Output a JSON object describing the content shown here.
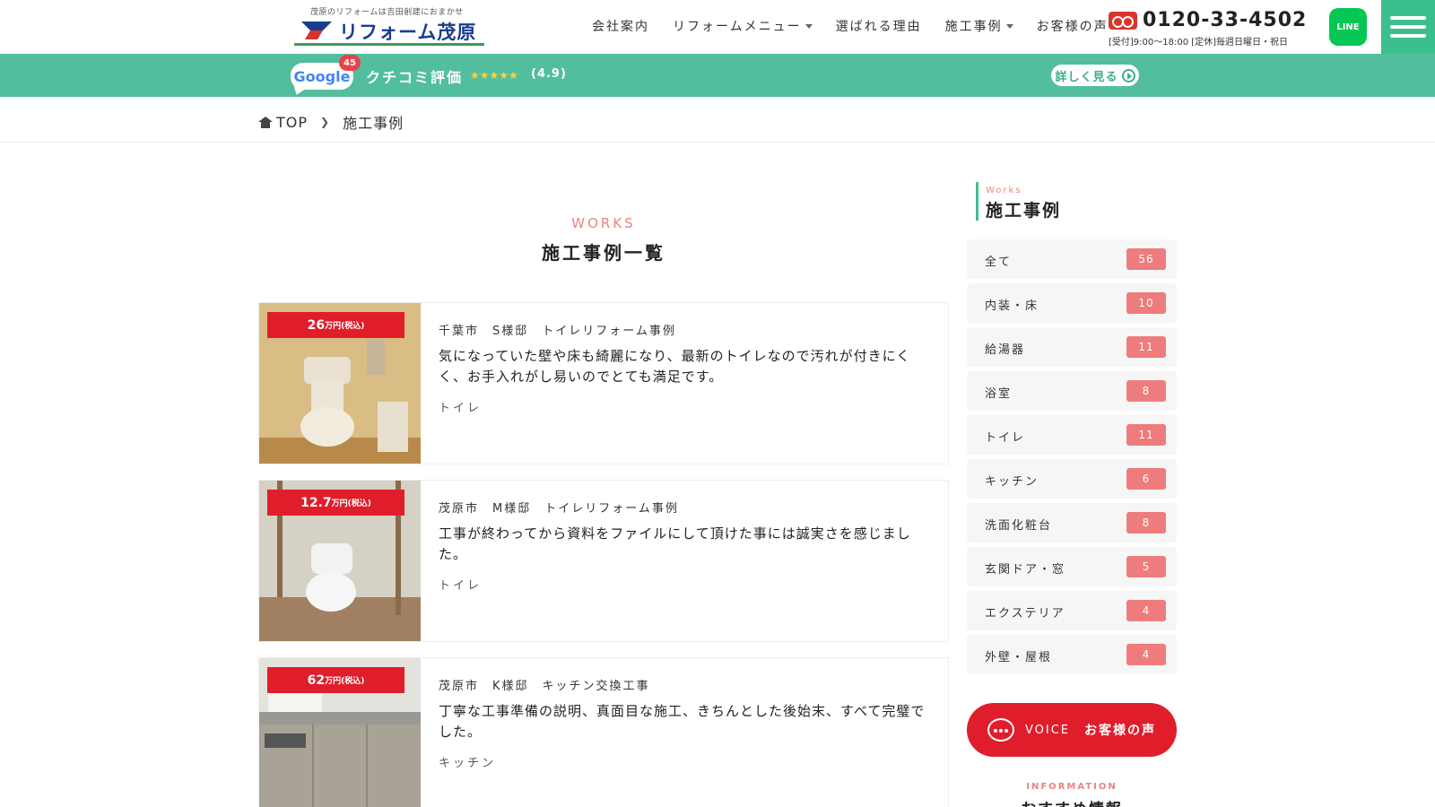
{
  "header": {
    "logo_tagline": "茂原のリフォームは吉田創建におまかせ",
    "logo_name": "リフォーム茂原",
    "nav": [
      {
        "label": "会社案内",
        "dropdown": false
      },
      {
        "label": "リフォームメニュー",
        "dropdown": true
      },
      {
        "label": "選ばれる理由",
        "dropdown": false
      },
      {
        "label": "施工事例",
        "dropdown": true
      },
      {
        "label": "お客様の声",
        "dropdown": false
      }
    ],
    "tel_number": "0120-33-4502",
    "tel_hours": "[受付]9:00〜18:00 [定休]毎週日曜日・祝日",
    "line_label": "LINE"
  },
  "review": {
    "google_label": "Google",
    "google_count": "45",
    "label": "クチコミ評価",
    "stars": "★★★★★",
    "score": "(4.9)",
    "detail_label": "詳しく見る"
  },
  "breadcrumb": {
    "home": "TOP",
    "current": "施工事例"
  },
  "main": {
    "heading_en": "WORKS",
    "heading_ja": "施工事例一覧",
    "cards": [
      {
        "price": "26",
        "unit": "万円(税込)",
        "title": "千葉市　S様邸　トイレリフォーム事例",
        "body": "気になっていた壁や床も綺麗になり、最新のトイレなので汚れが付きにくく、お手入れがし易いのでとても満足です。",
        "category": "トイレ"
      },
      {
        "price": "12.7",
        "unit": "万円(税込)",
        "title": "茂原市　M様邸　トイレリフォーム事例",
        "body": "工事が終わってから資料をファイルにして頂けた事には誠実さを感じました。",
        "category": "トイレ"
      },
      {
        "price": "62",
        "unit": "万円(税込)",
        "title": "茂原市　K様邸　キッチン交換工事",
        "body": "丁寧な工事準備の説明、真面目な施工、きちんとした後始末、すべて完璧でした。",
        "category": "キッチン"
      }
    ]
  },
  "sidebar": {
    "heading_en": "Works",
    "heading_ja": "施工事例",
    "categories": [
      {
        "label": "全て",
        "count": "56"
      },
      {
        "label": "内装・床",
        "count": "10"
      },
      {
        "label": "給湯器",
        "count": "11"
      },
      {
        "label": "浴室",
        "count": "8"
      },
      {
        "label": "トイレ",
        "count": "11"
      },
      {
        "label": "キッチン",
        "count": "6"
      },
      {
        "label": "洗面化粧台",
        "count": "8"
      },
      {
        "label": "玄関ドア・窓",
        "count": "5"
      },
      {
        "label": "エクステリア",
        "count": "4"
      },
      {
        "label": "外壁・屋根",
        "count": "4"
      }
    ],
    "voice_en": "VOICE",
    "voice_ja": "お客様の声",
    "info_en": "INFORMATION",
    "info_ja": "おすすめ情報"
  },
  "colors": {
    "accent_green": "#52be9e",
    "price_red": "#e01e2b",
    "count_pink": "#ee7c7c",
    "heading_pink": "#e8857e"
  }
}
